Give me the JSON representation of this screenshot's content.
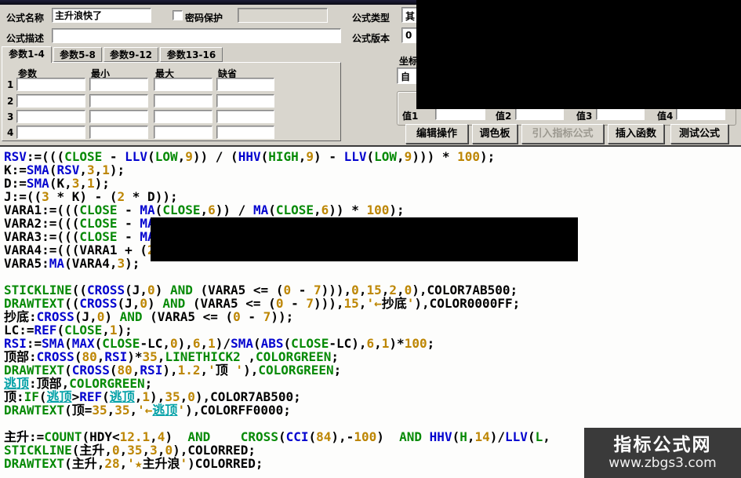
{
  "header": {
    "name_label": "公式名称",
    "name_value": "主升浪快了",
    "password_label": "密码保护",
    "password_value": "",
    "desc_label": "公式描述",
    "desc_value": "",
    "type_label": "公式类型",
    "type_value": "其",
    "version_label": "公式版本",
    "version_value": "0",
    "coord_label": "坐标",
    "coord_value": "自"
  },
  "tabs": [
    {
      "label": "参数1-4",
      "active": true
    },
    {
      "label": "参数5-8",
      "active": false
    },
    {
      "label": "参数9-12",
      "active": false
    },
    {
      "label": "参数13-16",
      "active": false
    }
  ],
  "param_table": {
    "headers": [
      "参数",
      "最小",
      "最大",
      "缺省"
    ],
    "row_numbers": [
      "1",
      "2",
      "3",
      "4"
    ],
    "cell_values": [
      "",
      "",
      "",
      "",
      "",
      "",
      "",
      "",
      "",
      "",
      "",
      "",
      "",
      "",
      "",
      ""
    ]
  },
  "values_row": [
    {
      "label": "值1",
      "value": ""
    },
    {
      "label": "值2",
      "value": ""
    },
    {
      "label": "值3",
      "value": ""
    },
    {
      "label": "值4",
      "value": ""
    }
  ],
  "action_buttons": [
    {
      "label": "编辑操作",
      "enabled": true
    },
    {
      "label": "调色板",
      "enabled": true
    },
    {
      "label": "引入指标公式",
      "enabled": false
    },
    {
      "label": "插入函数",
      "enabled": true
    },
    {
      "label": "测试公式",
      "enabled": true
    }
  ],
  "syntax_colors": {
    "function_blue": "#0404cf",
    "keyword_green": "#068a06",
    "number_gold": "#bd8603",
    "link_teal": "#06a2a8",
    "plain_black": "#000000"
  },
  "code": {
    "lines": [
      [
        [
          "RSV",
          "f"
        ],
        [
          ":=(((",
          "k"
        ],
        [
          "CLOSE",
          "g"
        ],
        [
          " - ",
          "k"
        ],
        [
          "LLV",
          "f"
        ],
        [
          "(",
          "k"
        ],
        [
          "LOW",
          "g"
        ],
        [
          ",",
          "k"
        ],
        [
          "9",
          "n"
        ],
        [
          ")) / (",
          "k"
        ],
        [
          "HHV",
          "f"
        ],
        [
          "(",
          "k"
        ],
        [
          "HIGH",
          "g"
        ],
        [
          ",",
          "k"
        ],
        [
          "9",
          "n"
        ],
        [
          ") - ",
          "k"
        ],
        [
          "LLV",
          "f"
        ],
        [
          "(",
          "k"
        ],
        [
          "LOW",
          "g"
        ],
        [
          ",",
          "k"
        ],
        [
          "9",
          "n"
        ],
        [
          "))) * ",
          "k"
        ],
        [
          "100",
          "n"
        ],
        [
          ");",
          "k"
        ]
      ],
      [
        [
          "K:=",
          "k"
        ],
        [
          "SMA",
          "f"
        ],
        [
          "(",
          "k"
        ],
        [
          "RSV",
          "f"
        ],
        [
          ",",
          "k"
        ],
        [
          "3",
          "n"
        ],
        [
          ",",
          "k"
        ],
        [
          "1",
          "n"
        ],
        [
          ");",
          "k"
        ]
      ],
      [
        [
          "D:=",
          "k"
        ],
        [
          "SMA",
          "f"
        ],
        [
          "(K,",
          "k"
        ],
        [
          "3",
          "n"
        ],
        [
          ",",
          "k"
        ],
        [
          "1",
          "n"
        ],
        [
          ");",
          "k"
        ]
      ],
      [
        [
          "J:=((",
          "k"
        ],
        [
          "3",
          "n"
        ],
        [
          " * K) - (",
          "k"
        ],
        [
          "2",
          "n"
        ],
        [
          " * D));",
          "k"
        ]
      ],
      [
        [
          "VARA1:=(((",
          "k"
        ],
        [
          "CLOSE",
          "g"
        ],
        [
          " - ",
          "k"
        ],
        [
          "MA",
          "f"
        ],
        [
          "(",
          "k"
        ],
        [
          "CLOSE",
          "g"
        ],
        [
          ",",
          "k"
        ],
        [
          "6",
          "n"
        ],
        [
          ")) / ",
          "k"
        ],
        [
          "MA",
          "f"
        ],
        [
          "(",
          "k"
        ],
        [
          "CLOSE",
          "g"
        ],
        [
          ",",
          "k"
        ],
        [
          "6",
          "n"
        ],
        [
          ")) * ",
          "k"
        ],
        [
          "100",
          "n"
        ],
        [
          ");",
          "k"
        ]
      ],
      [
        [
          "VARA2:=(((",
          "k"
        ],
        [
          "CLOSE",
          "g"
        ],
        [
          " - ",
          "k"
        ],
        [
          "MA",
          "f"
        ]
      ],
      [
        [
          "VARA3:=(((",
          "k"
        ],
        [
          "CLOSE",
          "g"
        ],
        [
          " - ",
          "k"
        ],
        [
          "MA",
          "f"
        ]
      ],
      [
        [
          "VARA4:=(((VARA1 + (",
          "k"
        ],
        [
          "2",
          "n"
        ]
      ],
      [
        [
          "VARA5:",
          "k"
        ],
        [
          "MA",
          "f"
        ],
        [
          "(VARA4,",
          "k"
        ],
        [
          "3",
          "n"
        ],
        [
          ");",
          "k"
        ]
      ],
      [],
      [
        [
          "STICKLINE",
          "g"
        ],
        [
          "((",
          "k"
        ],
        [
          "CROSS",
          "f"
        ],
        [
          "(J,",
          "k"
        ],
        [
          "0",
          "n"
        ],
        [
          ") ",
          "k"
        ],
        [
          "AND",
          "g"
        ],
        [
          " (VARA5 <= (",
          "k"
        ],
        [
          "0",
          "n"
        ],
        [
          " - ",
          "k"
        ],
        [
          "7",
          "n"
        ],
        [
          "))),",
          "k"
        ],
        [
          "0",
          "n"
        ],
        [
          ",",
          "k"
        ],
        [
          "15",
          "n"
        ],
        [
          ",",
          "k"
        ],
        [
          "2",
          "n"
        ],
        [
          ",",
          "k"
        ],
        [
          "0",
          "n"
        ],
        [
          "),COLOR7AB500;",
          "k"
        ]
      ],
      [
        [
          "DRAWTEXT",
          "g"
        ],
        [
          "((",
          "k"
        ],
        [
          "CROSS",
          "f"
        ],
        [
          "(J,",
          "k"
        ],
        [
          "0",
          "n"
        ],
        [
          ") ",
          "k"
        ],
        [
          "AND",
          "g"
        ],
        [
          " (VARA5 <= (",
          "k"
        ],
        [
          "0",
          "n"
        ],
        [
          " - ",
          "k"
        ],
        [
          "7",
          "n"
        ],
        [
          "))),",
          "k"
        ],
        [
          "15",
          "n"
        ],
        [
          ",",
          "k"
        ],
        [
          "'←",
          "n"
        ],
        [
          "抄底",
          "k"
        ],
        [
          "'",
          "n"
        ],
        [
          "),COLOR0000FF;",
          "k"
        ]
      ],
      [
        [
          "抄底:",
          "k"
        ],
        [
          "CROSS",
          "f"
        ],
        [
          "(J,",
          "k"
        ],
        [
          "0",
          "n"
        ],
        [
          ") ",
          "k"
        ],
        [
          "AND",
          "g"
        ],
        [
          " (VARA5 <= (",
          "k"
        ],
        [
          "0",
          "n"
        ],
        [
          " - ",
          "k"
        ],
        [
          "7",
          "n"
        ],
        [
          "));",
          "k"
        ]
      ],
      [
        [
          "LC:=",
          "k"
        ],
        [
          "REF",
          "f"
        ],
        [
          "(",
          "k"
        ],
        [
          "CLOSE",
          "g"
        ],
        [
          ",",
          "k"
        ],
        [
          "1",
          "n"
        ],
        [
          ");",
          "k"
        ]
      ],
      [
        [
          "RSI",
          "f"
        ],
        [
          ":=",
          "k"
        ],
        [
          "SMA",
          "f"
        ],
        [
          "(",
          "k"
        ],
        [
          "MAX",
          "f"
        ],
        [
          "(",
          "k"
        ],
        [
          "CLOSE",
          "g"
        ],
        [
          "-LC,",
          "k"
        ],
        [
          "0",
          "n"
        ],
        [
          "),",
          "k"
        ],
        [
          "6",
          "n"
        ],
        [
          ",",
          "k"
        ],
        [
          "1",
          "n"
        ],
        [
          ")/",
          "k"
        ],
        [
          "SMA",
          "f"
        ],
        [
          "(",
          "k"
        ],
        [
          "ABS",
          "f"
        ],
        [
          "(",
          "k"
        ],
        [
          "CLOSE",
          "g"
        ],
        [
          "-LC),",
          "k"
        ],
        [
          "6",
          "n"
        ],
        [
          ",",
          "k"
        ],
        [
          "1",
          "n"
        ],
        [
          ")*",
          "k"
        ],
        [
          "100",
          "n"
        ],
        [
          ";",
          "k"
        ]
      ],
      [
        [
          "顶部:",
          "k"
        ],
        [
          "CROSS",
          "f"
        ],
        [
          "(",
          "k"
        ],
        [
          "80",
          "n"
        ],
        [
          ",",
          "k"
        ],
        [
          "RSI",
          "f"
        ],
        [
          ")*",
          "k"
        ],
        [
          "35",
          "n"
        ],
        [
          ",",
          "k"
        ],
        [
          "LINETHICK2",
          "g"
        ],
        [
          " ,",
          "k"
        ],
        [
          "COLORGREEN",
          "g"
        ],
        [
          ";",
          "k"
        ]
      ],
      [
        [
          "DRAWTEXT",
          "g"
        ],
        [
          "(",
          "k"
        ],
        [
          "CROSS",
          "f"
        ],
        [
          "(",
          "k"
        ],
        [
          "80",
          "n"
        ],
        [
          ",",
          "k"
        ],
        [
          "RSI",
          "f"
        ],
        [
          "),",
          "k"
        ],
        [
          "1.2",
          "n"
        ],
        [
          ",",
          "k"
        ],
        [
          "'",
          "n"
        ],
        [
          "顶 ",
          "k"
        ],
        [
          "'",
          "n"
        ],
        [
          "),",
          "k"
        ],
        [
          "COLORGREEN",
          "g"
        ],
        [
          ";",
          "k"
        ]
      ],
      [
        [
          "逃顶",
          "t"
        ],
        [
          ":顶部,",
          "k"
        ],
        [
          "COLORGREEN",
          "g"
        ],
        [
          ";",
          "k"
        ]
      ],
      [
        [
          "顶:",
          "k"
        ],
        [
          "IF",
          "g"
        ],
        [
          "(",
          "k"
        ],
        [
          "逃顶",
          "t"
        ],
        [
          ">",
          "k"
        ],
        [
          "REF",
          "f"
        ],
        [
          "(",
          "k"
        ],
        [
          "逃顶",
          "t"
        ],
        [
          ",",
          "k"
        ],
        [
          "1",
          "n"
        ],
        [
          "),",
          "k"
        ],
        [
          "35",
          "n"
        ],
        [
          ",",
          "k"
        ],
        [
          "0",
          "n"
        ],
        [
          "),COLOR7AB500;",
          "k"
        ]
      ],
      [
        [
          "DRAWTEXT",
          "g"
        ],
        [
          "(顶=",
          "k"
        ],
        [
          "35",
          "n"
        ],
        [
          ",",
          "k"
        ],
        [
          "35",
          "n"
        ],
        [
          ",",
          "k"
        ],
        [
          "'←",
          "n"
        ],
        [
          "逃顶",
          "t"
        ],
        [
          "'",
          "n"
        ],
        [
          "),COLORFF0000;",
          "k"
        ]
      ],
      [],
      [
        [
          "主升:=",
          "k"
        ],
        [
          "COUNT",
          "g"
        ],
        [
          "(HDY<",
          "k"
        ],
        [
          "12.1",
          "n"
        ],
        [
          ",",
          "k"
        ],
        [
          "4",
          "n"
        ],
        [
          ")  ",
          "k"
        ],
        [
          "AND",
          "g"
        ],
        [
          "    ",
          "k"
        ],
        [
          "CROSS",
          "g"
        ],
        [
          "(",
          "k"
        ],
        [
          "CCI",
          "f"
        ],
        [
          "(",
          "k"
        ],
        [
          "84",
          "n"
        ],
        [
          "),-",
          "k"
        ],
        [
          "100",
          "n"
        ],
        [
          ")  ",
          "k"
        ],
        [
          "AND",
          "g"
        ],
        [
          " ",
          "k"
        ],
        [
          "HHV",
          "f"
        ],
        [
          "(",
          "k"
        ],
        [
          "H",
          "g"
        ],
        [
          ",",
          "k"
        ],
        [
          "14",
          "n"
        ],
        [
          ")/",
          "k"
        ],
        [
          "LLV",
          "f"
        ],
        [
          "(",
          "k"
        ],
        [
          "L",
          "g"
        ],
        [
          ",",
          "k"
        ]
      ],
      [
        [
          "STICKLINE",
          "g"
        ],
        [
          "(主升,",
          "k"
        ],
        [
          "0",
          "n"
        ],
        [
          ",",
          "k"
        ],
        [
          "35",
          "n"
        ],
        [
          ",",
          "k"
        ],
        [
          "3",
          "n"
        ],
        [
          ",",
          "k"
        ],
        [
          "0",
          "n"
        ],
        [
          "),COLORRED;",
          "k"
        ]
      ],
      [
        [
          "DRAWTEXT",
          "g"
        ],
        [
          "(主升,",
          "k"
        ],
        [
          "28",
          "n"
        ],
        [
          ",",
          "k"
        ],
        [
          "'★",
          "n"
        ],
        [
          "主升浪",
          "k"
        ],
        [
          "'",
          "n"
        ],
        [
          ")COLORRED;",
          "k"
        ]
      ]
    ]
  },
  "watermark": {
    "title": "指标公式网",
    "url": "www.zbgs3.com",
    "bg_color": "#3a3a3a"
  }
}
